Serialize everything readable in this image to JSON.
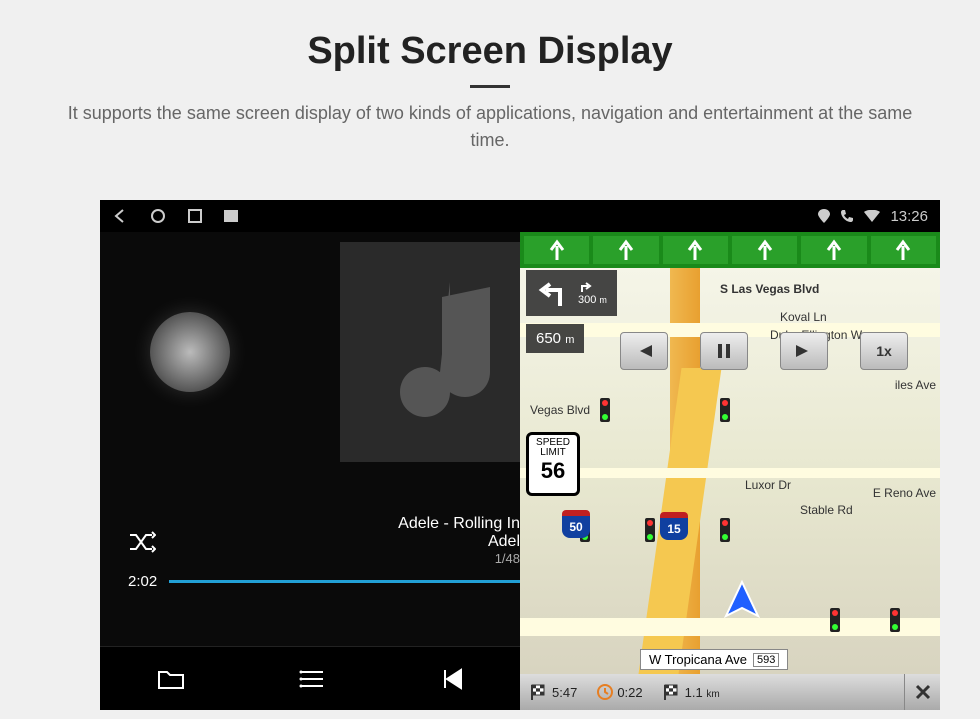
{
  "header": {
    "title": "Split Screen Display",
    "subtitle": "It supports the same screen display of two kinds of applications, navigation and entertainment at the same time."
  },
  "status_bar": {
    "time": "13:26"
  },
  "music": {
    "title_line1": "Adele - Rolling In",
    "title_line2": "Adel",
    "track_index": "1/48",
    "elapsed": "2:02"
  },
  "nav": {
    "turn_distance_small": "300",
    "turn_unit_small": "m",
    "turn_distance": "650",
    "turn_distance_unit": "m",
    "speed_limit_label": "SPEED LIMIT",
    "speed_limit_value": "56",
    "highway_shield_1": "50",
    "highway_shield_2": "15",
    "speed_multiplier": "1x",
    "streets": {
      "s_las_vegas": "S Las Vegas Blvd",
      "koval_ln": "Koval Ln",
      "duke_ellington": "Duke Ellington Way",
      "vegas_blvd_side": "Vegas Blvd",
      "luxor_dr": "Luxor Dr",
      "stable_rd": "Stable Rd",
      "e_reno_ave": "E Reno Ave",
      "tropicana": "W Tropicana Ave",
      "tropicana_num": "593",
      "giles_st": "s Ave",
      "iles_ave": "iles Ave"
    },
    "bottom": {
      "eta": "5:47",
      "time_remaining": "0:22",
      "distance": "1.1",
      "distance_unit": "km"
    }
  }
}
